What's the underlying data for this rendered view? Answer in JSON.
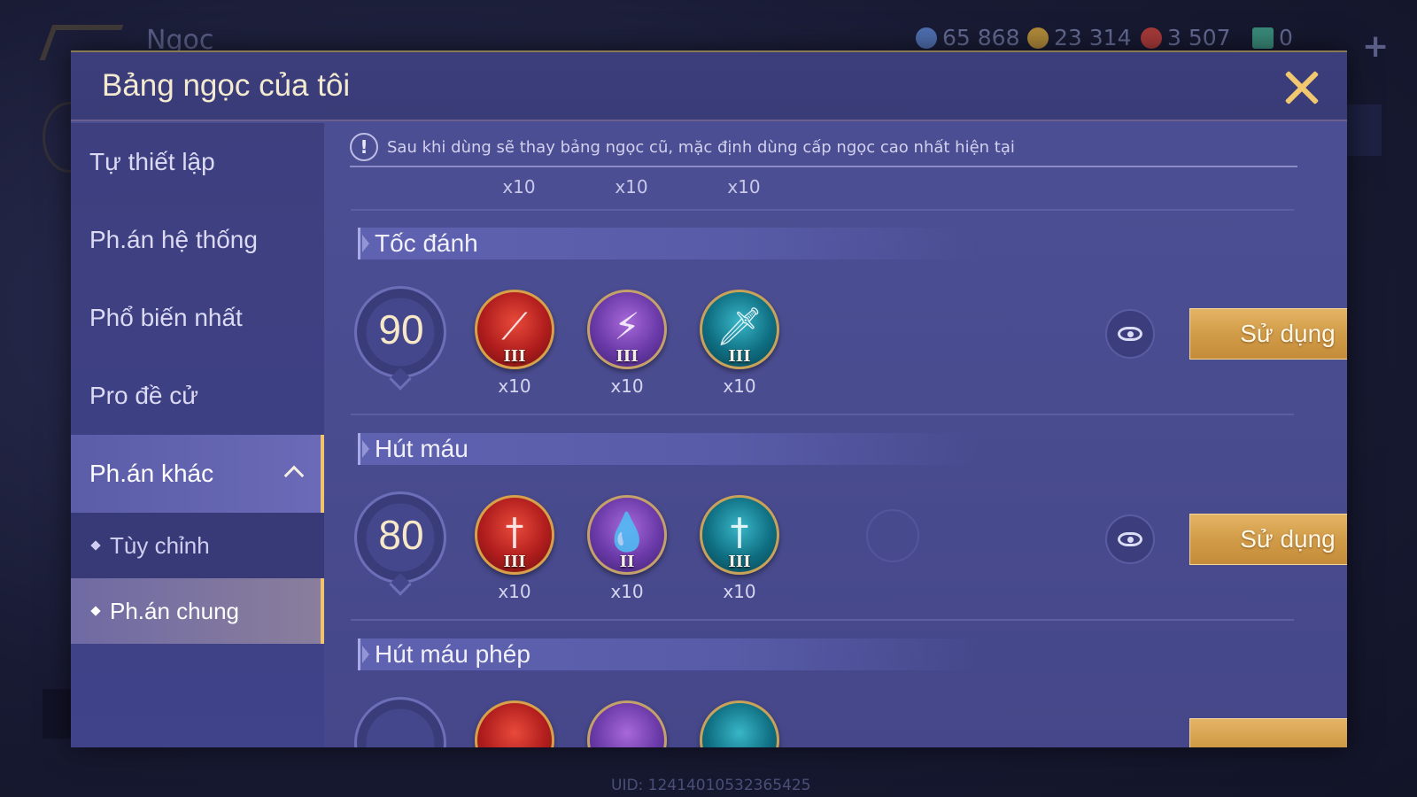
{
  "background": {
    "screen_title": "Ngọc",
    "currencies": [
      {
        "icon": "gem-coin-icon",
        "value": "65 868",
        "color": "#4f6fb0"
      },
      {
        "icon": "gold-coin-icon",
        "value": "23 314",
        "color": "#b08a3a"
      },
      {
        "icon": "red-voucher-icon",
        "value": "3 507",
        "color": "#a83a3a"
      },
      {
        "icon": "card-icon",
        "value": "0",
        "color": "#3a8a7a"
      }
    ],
    "uid": "UID: 12414010532365425"
  },
  "dialog": {
    "title": "Bảng ngọc của tôi",
    "notice": "Sau khi dùng sẽ thay bảng ngọc cũ, mặc định dùng cấp ngọc cao nhất hiện tại"
  },
  "sidebar": {
    "items": [
      {
        "label": "Tự thiết lập"
      },
      {
        "label": "Ph.án hệ thống"
      },
      {
        "label": "Phổ biến nhất"
      },
      {
        "label": "Pro đề cử"
      },
      {
        "label": "Ph.án khác"
      }
    ],
    "subitems": [
      {
        "label": "Tùy chỉnh"
      },
      {
        "label": "Ph.án chung"
      }
    ]
  },
  "partial_row": {
    "quantities": [
      "x10",
      "x10",
      "x10"
    ]
  },
  "sections": [
    {
      "title": "Tốc đánh",
      "level": "90",
      "gems": [
        {
          "color": "red",
          "icon": "blade-icon",
          "tier": "III",
          "qty": "x10"
        },
        {
          "color": "purple",
          "icon": "lightning-icon",
          "tier": "III",
          "qty": "x10"
        },
        {
          "color": "teal",
          "icon": "sword-icon",
          "tier": "III",
          "qty": "x10"
        }
      ],
      "use_label": "Sử dụng"
    },
    {
      "title": "Hút máu",
      "level": "80",
      "gems": [
        {
          "color": "red",
          "icon": "sword-icon",
          "tier": "III",
          "qty": "x10"
        },
        {
          "color": "purple",
          "icon": "droplet-icon",
          "tier": "II",
          "qty": "x10"
        },
        {
          "color": "teal",
          "icon": "sword-icon",
          "tier": "III",
          "qty": "x10"
        }
      ],
      "use_label": "Sử dụng"
    },
    {
      "title": "Hút máu phép"
    }
  ],
  "colors": {
    "accent_gold": "#f0c46e",
    "dialog_bg": "#4a4c90",
    "use_button": "#d19c48"
  }
}
